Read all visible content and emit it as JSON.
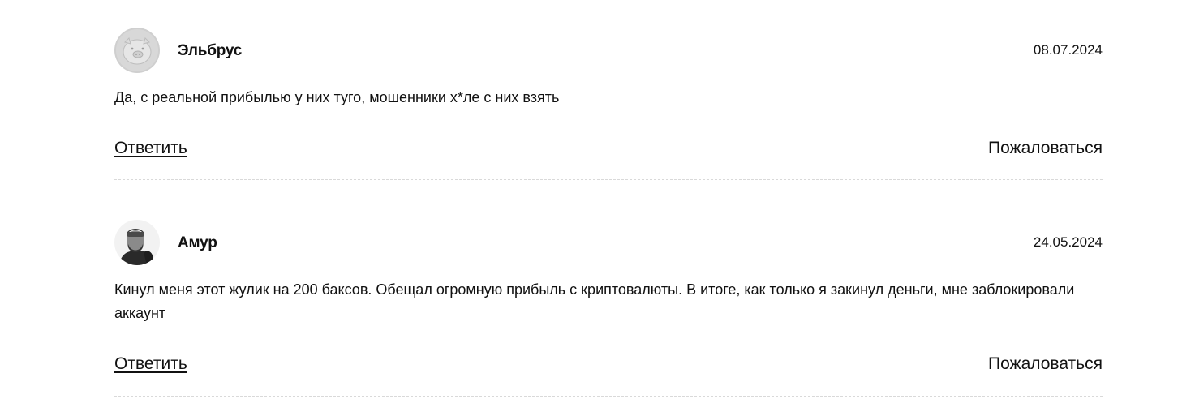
{
  "comments": [
    {
      "author": "Эльбрус",
      "date": "08.07.2024",
      "text": "Да, с реальной прибылью у них туго, мошенники х*ле с них взять",
      "reply_label": "Ответить",
      "report_label": "Пожаловаться"
    },
    {
      "author": "Амур",
      "date": "24.05.2024",
      "text": "Кинул меня этот жулик на 200 баксов. Обещал огромную прибыль с криптовалюты. В итоге, как только я закинул деньги, мне заблокировали аккаунт",
      "reply_label": "Ответить",
      "report_label": "Пожаловаться"
    }
  ],
  "colors": {
    "text": "#111111",
    "divider": "#d9d9d9",
    "background": "#ffffff"
  }
}
